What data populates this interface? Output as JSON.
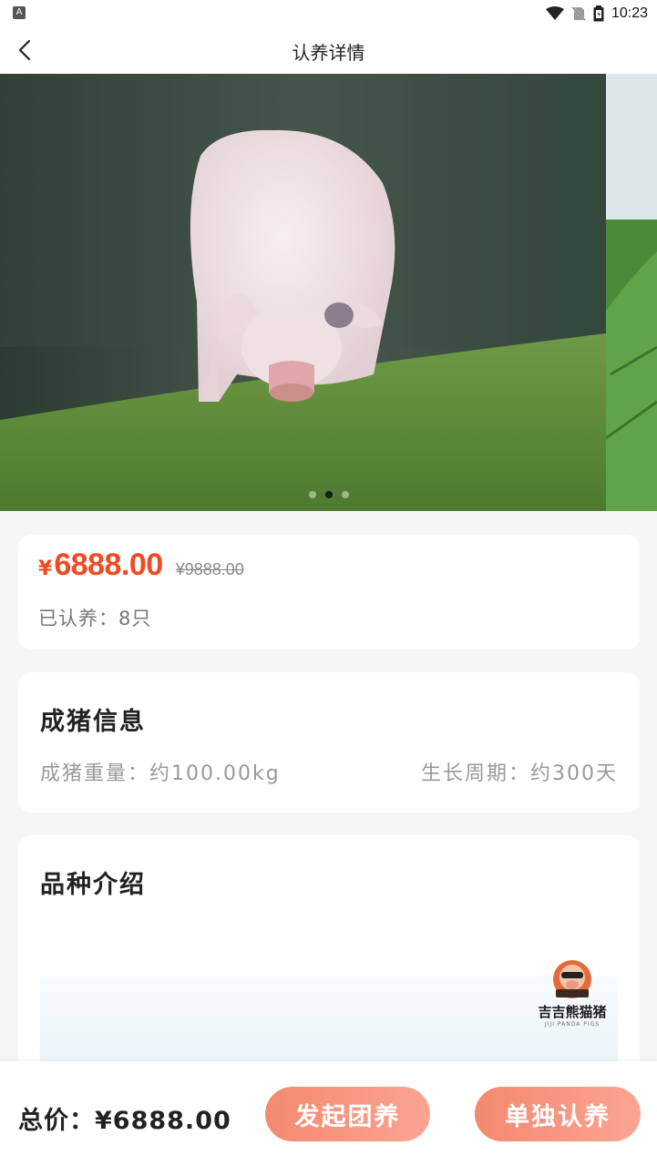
{
  "status_bar": {
    "time": "10:23"
  },
  "nav": {
    "title": "认养详情"
  },
  "carousel": {
    "slide_count": 3,
    "active_index": 1
  },
  "price": {
    "currency": "¥",
    "current": "6888.00",
    "original": "¥9888.00",
    "adopted": "已认养：8只"
  },
  "pig_info": {
    "title": "成猪信息",
    "weight": "成猪重量：约100.00kg",
    "cycle": "生长周期：约300天"
  },
  "breed": {
    "title": "品种介绍",
    "brand_name": "吉吉熊猫猪",
    "brand_sub": "JIJI PANDA PIGS"
  },
  "bottom": {
    "total": "总价：¥6888.00",
    "group_btn": "发起团养",
    "solo_btn": "单独认养"
  },
  "colors": {
    "accent": "#f04a23",
    "button": "#f38a70"
  }
}
